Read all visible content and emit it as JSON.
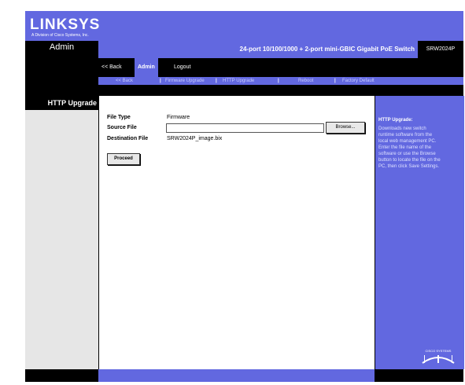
{
  "brand": {
    "logo": "LINKSYS",
    "tagline": "A Division of Cisco Systems, Inc."
  },
  "header": {
    "section_title": "Admin",
    "product_name": "24-port 10/100/1000 + 2-port mini-GBIC Gigabit PoE Switch",
    "model": "SRW2024P"
  },
  "nav": {
    "back": "<< Back",
    "admin": "Admin",
    "logout": "Logout"
  },
  "subnav": {
    "back": "<< Back",
    "firmware_upgrade": "Firmware Upgrade",
    "http_upgrade": "HTTP Upgrade",
    "reboot": "Reboot",
    "factory_default": "Factory Default",
    "separator": "|"
  },
  "page": {
    "title": "HTTP Upgrade"
  },
  "form": {
    "file_type_label": "File Type",
    "file_type_value": "Firmware",
    "source_file_label": "Source File",
    "source_file_value": "",
    "browse_label": "Browse...",
    "destination_file_label": "Destination File",
    "destination_file_value": "SRW2024P_image.bix",
    "proceed_label": "Proceed"
  },
  "help": {
    "title": "HTTP Upgrade:",
    "text": "Downloads new switch runtime software from the local web management PC. Enter the file name of the software or use the Browse button to locate the file on the PC, then click Save Settings."
  },
  "footer": {
    "cisco_logo": "CISCO SYSTEMS"
  },
  "colors": {
    "accent": "#6268e0",
    "dark": "#000000",
    "panel": "#e6e6e6"
  }
}
